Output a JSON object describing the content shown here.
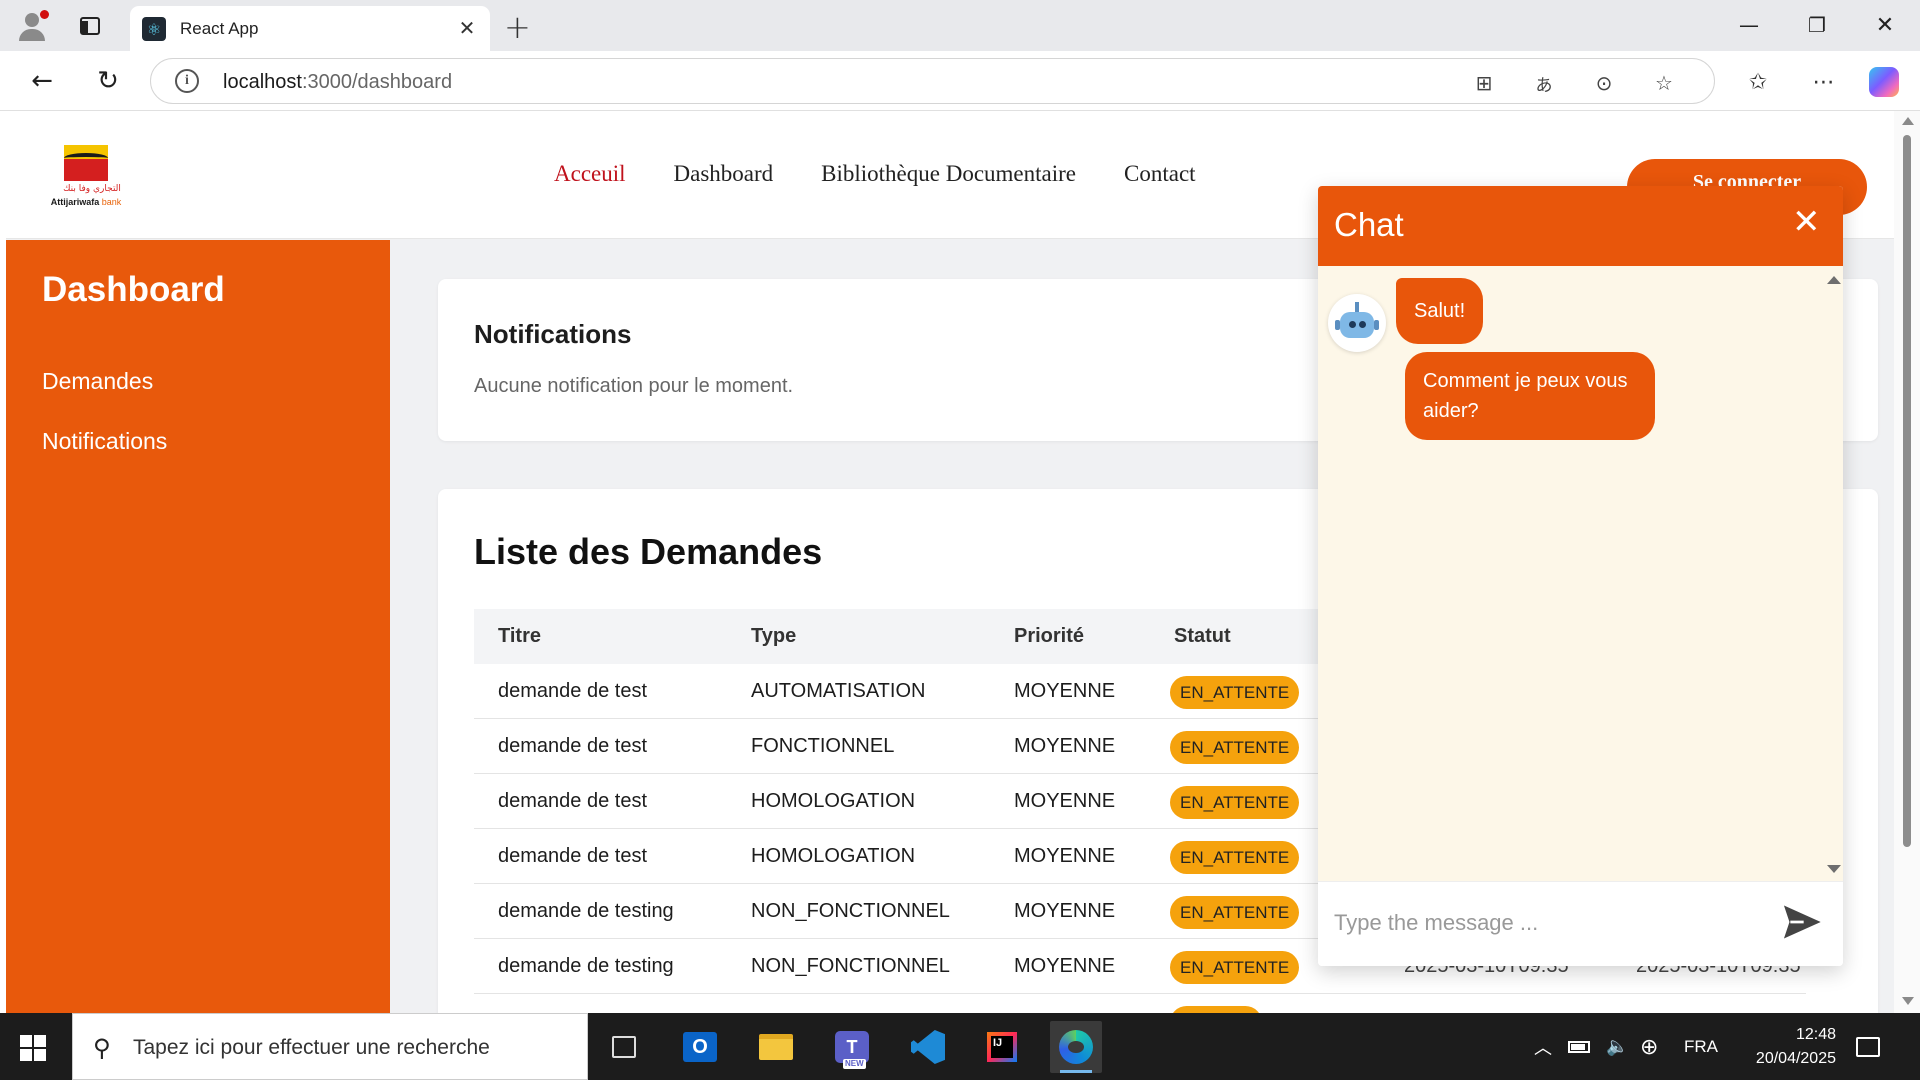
{
  "browser": {
    "tab_title": "React App",
    "url_host": "localhost",
    "url_path": ":3000/dashboard"
  },
  "site": {
    "logo_arabic": "التجاري وفا بنك",
    "logo_latin_main": "Attijariwafa",
    "logo_latin_sub": "bank",
    "nav": [
      "Acceuil",
      "Dashboard",
      "Bibliothèque Documentaire",
      "Contact"
    ],
    "login_label": "Se connecter"
  },
  "sidebar": {
    "title": "Dashboard",
    "items": [
      "Demandes",
      "Notifications"
    ]
  },
  "notifications": {
    "title": "Notifications",
    "empty_text": "Aucune notification pour le moment."
  },
  "demandes": {
    "title": "Liste des Demandes",
    "headers": [
      "Titre",
      "Type",
      "Priorité",
      "Statut"
    ],
    "rows": [
      {
        "titre": "demande de test",
        "type": "AUTOMATISATION",
        "priorite": "MOYENNE",
        "statut": "EN_ATTENTE",
        "date1": "",
        "date2": ""
      },
      {
        "titre": "demande de test",
        "type": "FONCTIONNEL",
        "priorite": "MOYENNE",
        "statut": "EN_ATTENTE",
        "date1": "",
        "date2": ""
      },
      {
        "titre": "demande de test",
        "type": "HOMOLOGATION",
        "priorite": "MOYENNE",
        "statut": "EN_ATTENTE",
        "date1": "",
        "date2": ""
      },
      {
        "titre": "demande de test",
        "type": "HOMOLOGATION",
        "priorite": "MOYENNE",
        "statut": "EN_ATTENTE",
        "date1": "",
        "date2": ""
      },
      {
        "titre": "demande de testing",
        "type": "NON_FONCTIONNEL",
        "priorite": "MOYENNE",
        "statut": "EN_ATTENTE",
        "date1": "",
        "date2": ""
      },
      {
        "titre": "demande de testing",
        "type": "NON_FONCTIONNEL",
        "priorite": "MOYENNE",
        "statut": "EN_ATTENTE",
        "date1": "2025-03-10T09:35",
        "date2": "2025-03-10T09:35"
      }
    ],
    "status_color": "#f5a20d"
  },
  "chat": {
    "title": "Chat",
    "messages": [
      "Salut!",
      "Comment je peux vous aider?"
    ],
    "input_placeholder": "Type the message ...",
    "accent": "#e8560b",
    "background": "#fdf7e8"
  },
  "taskbar": {
    "search_placeholder": "Tapez ici pour effectuer une recherche",
    "teams_badge": "NEW",
    "language": "FRA",
    "time": "12:48",
    "date": "20/04/2025"
  },
  "colors": {
    "brand_orange": "#e8590c",
    "nav_active": "#c0121c"
  }
}
